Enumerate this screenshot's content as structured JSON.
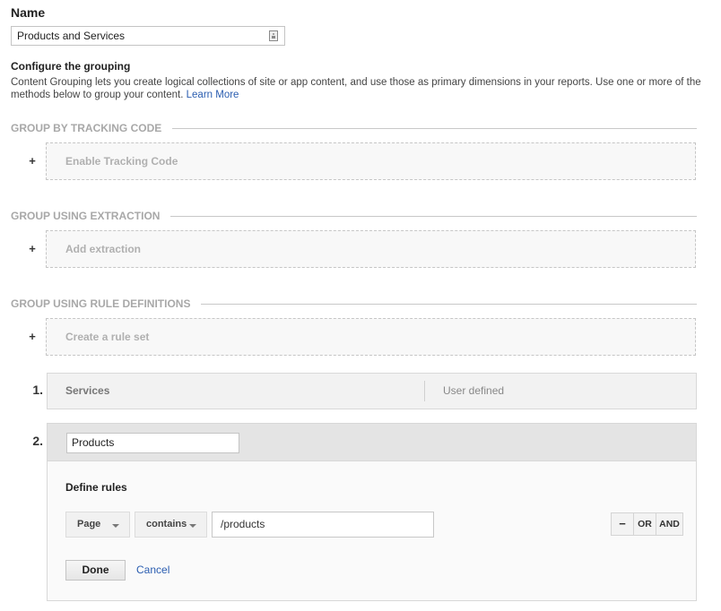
{
  "name_section": {
    "label": "Name",
    "value": "Products and Services",
    "field_icon": "contact-card-icon"
  },
  "configure": {
    "title": "Configure the grouping",
    "description": "Content Grouping lets you create logical collections of site or app content, and use those as primary dimensions in your reports. Use one or more of the methods below to group your content.",
    "learn_more": "Learn More"
  },
  "sections": {
    "tracking": {
      "title": "GROUP BY TRACKING CODE",
      "add_label": "Enable Tracking Code",
      "plus": "+"
    },
    "extraction": {
      "title": "GROUP USING EXTRACTION",
      "add_label": "Add extraction",
      "plus": "+"
    },
    "rules": {
      "title": "GROUP USING RULE DEFINITIONS",
      "add_label": "Create a rule set",
      "plus": "+"
    }
  },
  "rule_sets": [
    {
      "number": "1.",
      "name": "Services",
      "type": "User defined"
    },
    {
      "number": "2.",
      "name": "Products",
      "define_title": "Define rules",
      "dimension": "Page",
      "operator": "contains",
      "value": "/products",
      "remove_label": "−",
      "or_label": "OR",
      "and_label": "AND",
      "done_label": "Done",
      "cancel_label": "Cancel"
    }
  ]
}
